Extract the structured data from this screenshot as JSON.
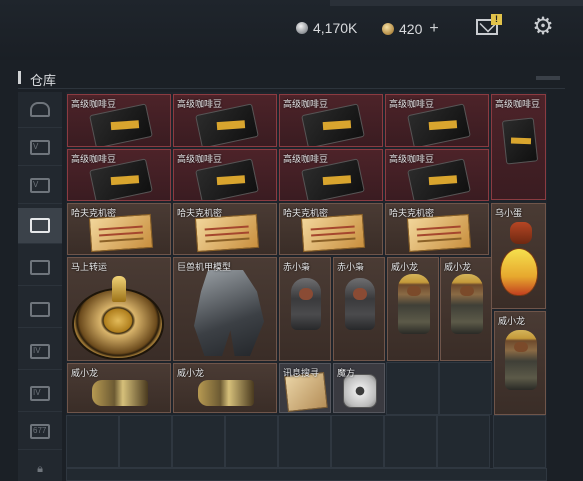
{
  "currencies": {
    "silver_amount": "4,170K",
    "gold_amount": "420",
    "add_symbol": "+"
  },
  "header": {
    "mail_badge": "!",
    "settings_icon": "gear-icon"
  },
  "warehouse": {
    "title": "仓库"
  },
  "sidebar": {
    "tabs": [
      {
        "icon": "home-icon",
        "label": ""
      },
      {
        "icon": "storage-v-icon",
        "label": "V"
      },
      {
        "icon": "storage-v-icon",
        "label": "V"
      },
      {
        "icon": "storage-search-icon",
        "label": "",
        "active": true
      },
      {
        "icon": "storage-box-icon",
        "label": ""
      },
      {
        "icon": "storage-box-icon",
        "label": ""
      },
      {
        "icon": "storage-iv-icon",
        "label": "IV"
      },
      {
        "icon": "storage-iv-icon",
        "label": "IV"
      },
      {
        "icon": "storage-level-icon",
        "label": "677"
      },
      {
        "icon": "lock-icon",
        "label": ""
      }
    ]
  },
  "items": [
    {
      "name": "高级咖啡豆",
      "art": "coffee-bag-icon"
    },
    {
      "name": "高级咖啡豆",
      "art": "coffee-bag-icon"
    },
    {
      "name": "高级咖啡豆",
      "art": "coffee-bag-icon"
    },
    {
      "name": "高级咖啡豆",
      "art": "coffee-bag-icon"
    },
    {
      "name": "高级咖啡豆",
      "art": "coffee-bag-tall-icon"
    },
    {
      "name": "高级咖啡豆",
      "art": "coffee-bag-icon"
    },
    {
      "name": "高级咖啡豆",
      "art": "coffee-bag-icon"
    },
    {
      "name": "高级咖啡豆",
      "art": "coffee-bag-icon"
    },
    {
      "name": "高级咖啡豆",
      "art": "coffee-bag-icon"
    },
    {
      "name": "哈夫克机密",
      "art": "map-icon"
    },
    {
      "name": "哈夫克机密",
      "art": "map-icon"
    },
    {
      "name": "哈夫克机密",
      "art": "map-icon"
    },
    {
      "name": "哈夫克机密",
      "art": "map-icon"
    },
    {
      "name": "乌小蛋",
      "art": "egg-icon"
    },
    {
      "name": "马上转运",
      "art": "wheel-icon"
    },
    {
      "name": "巨兽机甲模型",
      "art": "mech-icon"
    },
    {
      "name": "赤小枭",
      "art": "hooded-figure-icon"
    },
    {
      "name": "赤小枭",
      "art": "hooded-figure-icon"
    },
    {
      "name": "威小龙",
      "art": "soldier-figure-icon"
    },
    {
      "name": "威小龙",
      "art": "soldier-figure-icon"
    },
    {
      "name": "威小龙",
      "art": "soldier-figure-icon"
    },
    {
      "name": "威小龙",
      "art": "dragon-icon"
    },
    {
      "name": "威小龙",
      "art": "dragon-icon"
    },
    {
      "name": "讯息搜寻",
      "art": "paper-icon"
    },
    {
      "name": "魔方",
      "art": "cube-icon"
    }
  ],
  "colors": {
    "rare_red": "#4d2329",
    "brown": "#4a3b34",
    "slate": "#3a3a40",
    "accent_badge": "#e1c24a"
  }
}
